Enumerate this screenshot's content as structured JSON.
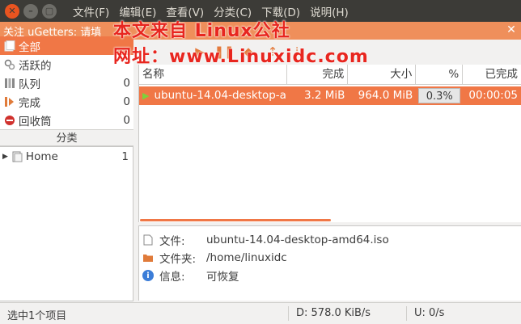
{
  "window": {
    "menu": [
      "文件(F)",
      "编辑(E)",
      "查看(V)",
      "分类(C)",
      "下载(D)",
      "说明(H)"
    ]
  },
  "notice": {
    "text": "关注 uGetters: 请填",
    "close_label": "✕"
  },
  "watermark": {
    "line1": "本文来自 Linux公社",
    "line2": "网址：www.Linuxidc.com"
  },
  "sidebar": {
    "status_items": [
      {
        "label": "全部",
        "count": "",
        "icon": "all-icon"
      },
      {
        "label": "活跃的",
        "count": "",
        "icon": "active-icon"
      },
      {
        "label": "队列",
        "count": "0",
        "icon": "queue-icon"
      },
      {
        "label": "完成",
        "count": "0",
        "icon": "finished-icon"
      },
      {
        "label": "回收筒",
        "count": "0",
        "icon": "recycle-icon"
      }
    ],
    "category_header": "分类",
    "categories": [
      {
        "label": "Home",
        "count": "1",
        "icon": "category-icon"
      }
    ]
  },
  "table": {
    "columns": [
      "名称",
      "完成",
      "大小",
      "%",
      "已完成"
    ],
    "rows": [
      {
        "name": "ubuntu-14.04-desktop-a",
        "done": "3.2 MiB",
        "size": "964.0 MiB",
        "percent": "0.3%",
        "elapsed": "00:00:05",
        "progress": 0.3
      }
    ]
  },
  "details": {
    "file_label": "文件:",
    "file_value": "ubuntu-14.04-desktop-amd64.iso",
    "folder_label": "文件夹:",
    "folder_value": "/home/linuxidc",
    "info_label": "信息:",
    "info_value": "可恢复"
  },
  "status": {
    "selection": "选中1个项目",
    "download": "D:  578.0 KiB/s",
    "upload": "U:  0/s"
  },
  "colors": {
    "accent": "#f07746",
    "titlebar": "#3c3b37",
    "watermark": "#e8261f"
  }
}
